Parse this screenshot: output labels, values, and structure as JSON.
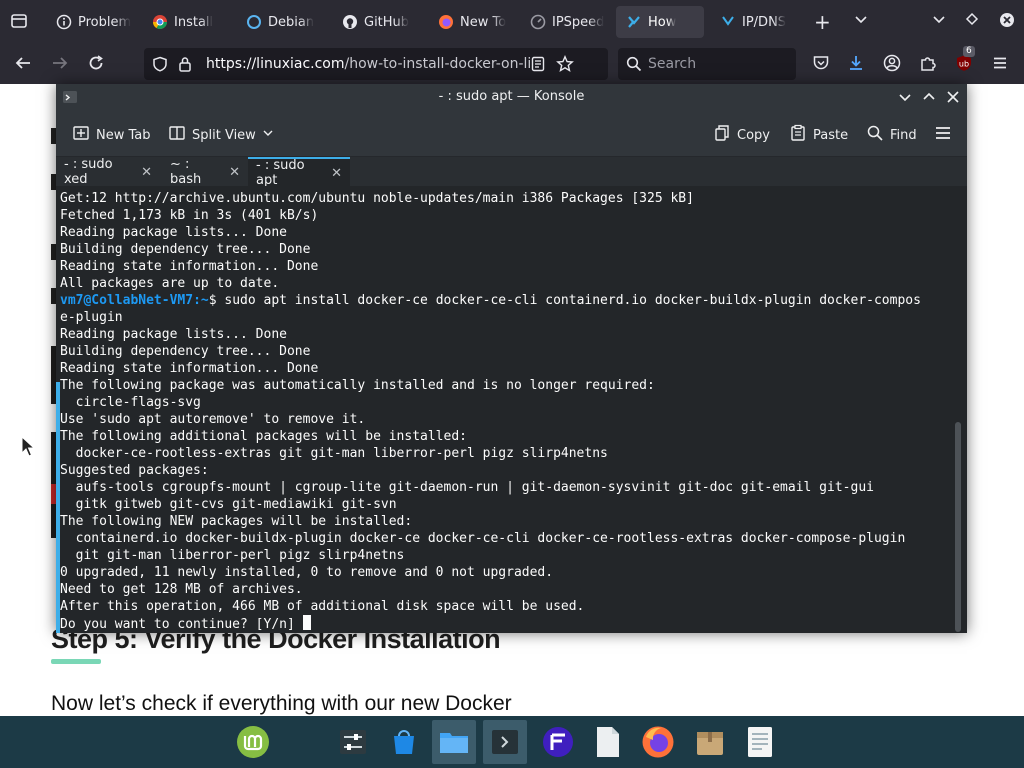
{
  "browser": {
    "tabs": [
      {
        "label": "Problem",
        "icon": "circle-info-icon",
        "active": false
      },
      {
        "label": "Install",
        "icon": "chrome-style-icon",
        "active": false
      },
      {
        "label": "Debian",
        "icon": "debian-icon",
        "active": false
      },
      {
        "label": "GitHub",
        "icon": "github-icon",
        "active": false
      },
      {
        "label": "New To",
        "icon": "firefox-icon",
        "active": false
      },
      {
        "label": "IPSpeed",
        "icon": "speed-icon",
        "active": false
      },
      {
        "label": "How",
        "icon": "linuxiac-icon",
        "active": true
      },
      {
        "label": "IP/DNS",
        "icon": "ip-icon",
        "active": false
      }
    ],
    "url_host": "https://linuxiac.com",
    "url_path": "/how-to-install-docker-on-li",
    "search_placeholder": "Search",
    "extension_badge": "6"
  },
  "page": {
    "heading": "Step 5: Verify the Docker Installation",
    "paragraph": "Now let’s check if everything with our new Docker"
  },
  "konsole": {
    "title": "- : sudo apt — Konsole",
    "toolbar": {
      "new_tab": "New Tab",
      "split_view": "Split View",
      "copy": "Copy",
      "paste": "Paste",
      "find": "Find"
    },
    "tabs": [
      {
        "label": "- : sudo xed",
        "active": false
      },
      {
        "label": "~ : bash",
        "active": false
      },
      {
        "label": "- : sudo apt",
        "active": true
      }
    ],
    "prompt_user": "vm7@CollabNet-VM7",
    "prompt_path": ":~",
    "lines": [
      "Get:12 http://archive.ubuntu.com/ubuntu noble-updates/main i386 Packages [325 kB]",
      "Fetched 1,173 kB in 3s (401 kB/s)",
      "Reading package lists... Done",
      "Building dependency tree... Done",
      "Reading state information... Done",
      "All packages are up to date.",
      "$ sudo apt install docker-ce docker-ce-cli containerd.io docker-buildx-plugin docker-compos",
      "e-plugin",
      "Reading package lists... Done",
      "Building dependency tree... Done",
      "Reading state information... Done",
      "The following package was automatically installed and is no longer required:",
      "  circle-flags-svg",
      "Use 'sudo apt autoremove' to remove it.",
      "The following additional packages will be installed:",
      "  docker-ce-rootless-extras git git-man liberror-perl pigz slirp4netns",
      "Suggested packages:",
      "  aufs-tools cgroupfs-mount | cgroup-lite git-daemon-run | git-daemon-sysvinit git-doc git-email git-gui",
      "  gitk gitweb git-cvs git-mediawiki git-svn",
      "The following NEW packages will be installed:",
      "  containerd.io docker-buildx-plugin docker-ce docker-ce-cli docker-ce-rootless-extras docker-compose-plugin",
      "  git git-man liberror-perl pigz slirp4netns",
      "0 upgraded, 11 newly installed, 0 to remove and 0 not upgraded.",
      "Need to get 128 MB of archives.",
      "After this operation, 466 MB of additional disk space will be used.",
      "Do you want to continue? [Y/n] "
    ]
  },
  "dock": [
    {
      "name": "mint-menu-icon"
    },
    {
      "name": "settings-mixer-icon"
    },
    {
      "name": "software-store-icon"
    },
    {
      "name": "file-manager-icon"
    },
    {
      "name": "terminal-icon"
    },
    {
      "name": "floorp-icon"
    },
    {
      "name": "text-file-icon"
    },
    {
      "name": "firefox-icon"
    },
    {
      "name": "archive-manager-icon"
    },
    {
      "name": "text-editor-icon"
    }
  ]
}
